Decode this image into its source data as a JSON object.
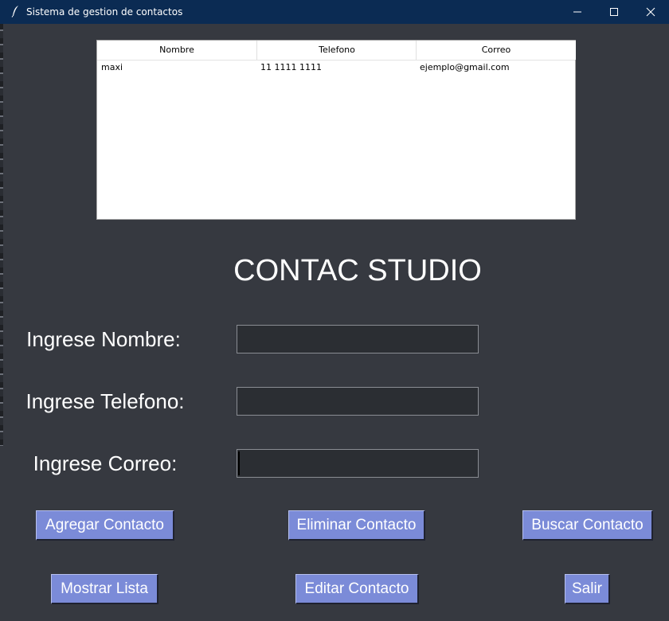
{
  "window": {
    "title": "Sistema de gestion de contactos"
  },
  "table": {
    "columns": [
      "Nombre",
      "Telefono",
      "Correo"
    ],
    "rows": [
      [
        "maxi",
        "11 1111 1111",
        "ejemplo@gmail.com"
      ]
    ]
  },
  "heading": "CONTAC STUDIO",
  "form": {
    "nombre_label": "Ingrese Nombre:",
    "nombre_value": "",
    "telefono_label": "Ingrese Telefono:",
    "telefono_value": "",
    "correo_label": "Ingrese Correo:",
    "correo_value": ""
  },
  "buttons": {
    "agregar": "Agregar Contacto",
    "eliminar": "Eliminar Contacto",
    "buscar": "Buscar Contacto",
    "mostrar": "Mostrar Lista",
    "editar": "Editar Contacto",
    "salir": "Salir"
  },
  "colors": {
    "titlebar": "#0b2b53",
    "background": "#363940",
    "button": "#7b8bd8",
    "entry": "#2b2e33"
  },
  "icons": {
    "app": "feather-icon",
    "minimize": "minimize-icon",
    "maximize": "maximize-icon",
    "close": "close-icon"
  }
}
